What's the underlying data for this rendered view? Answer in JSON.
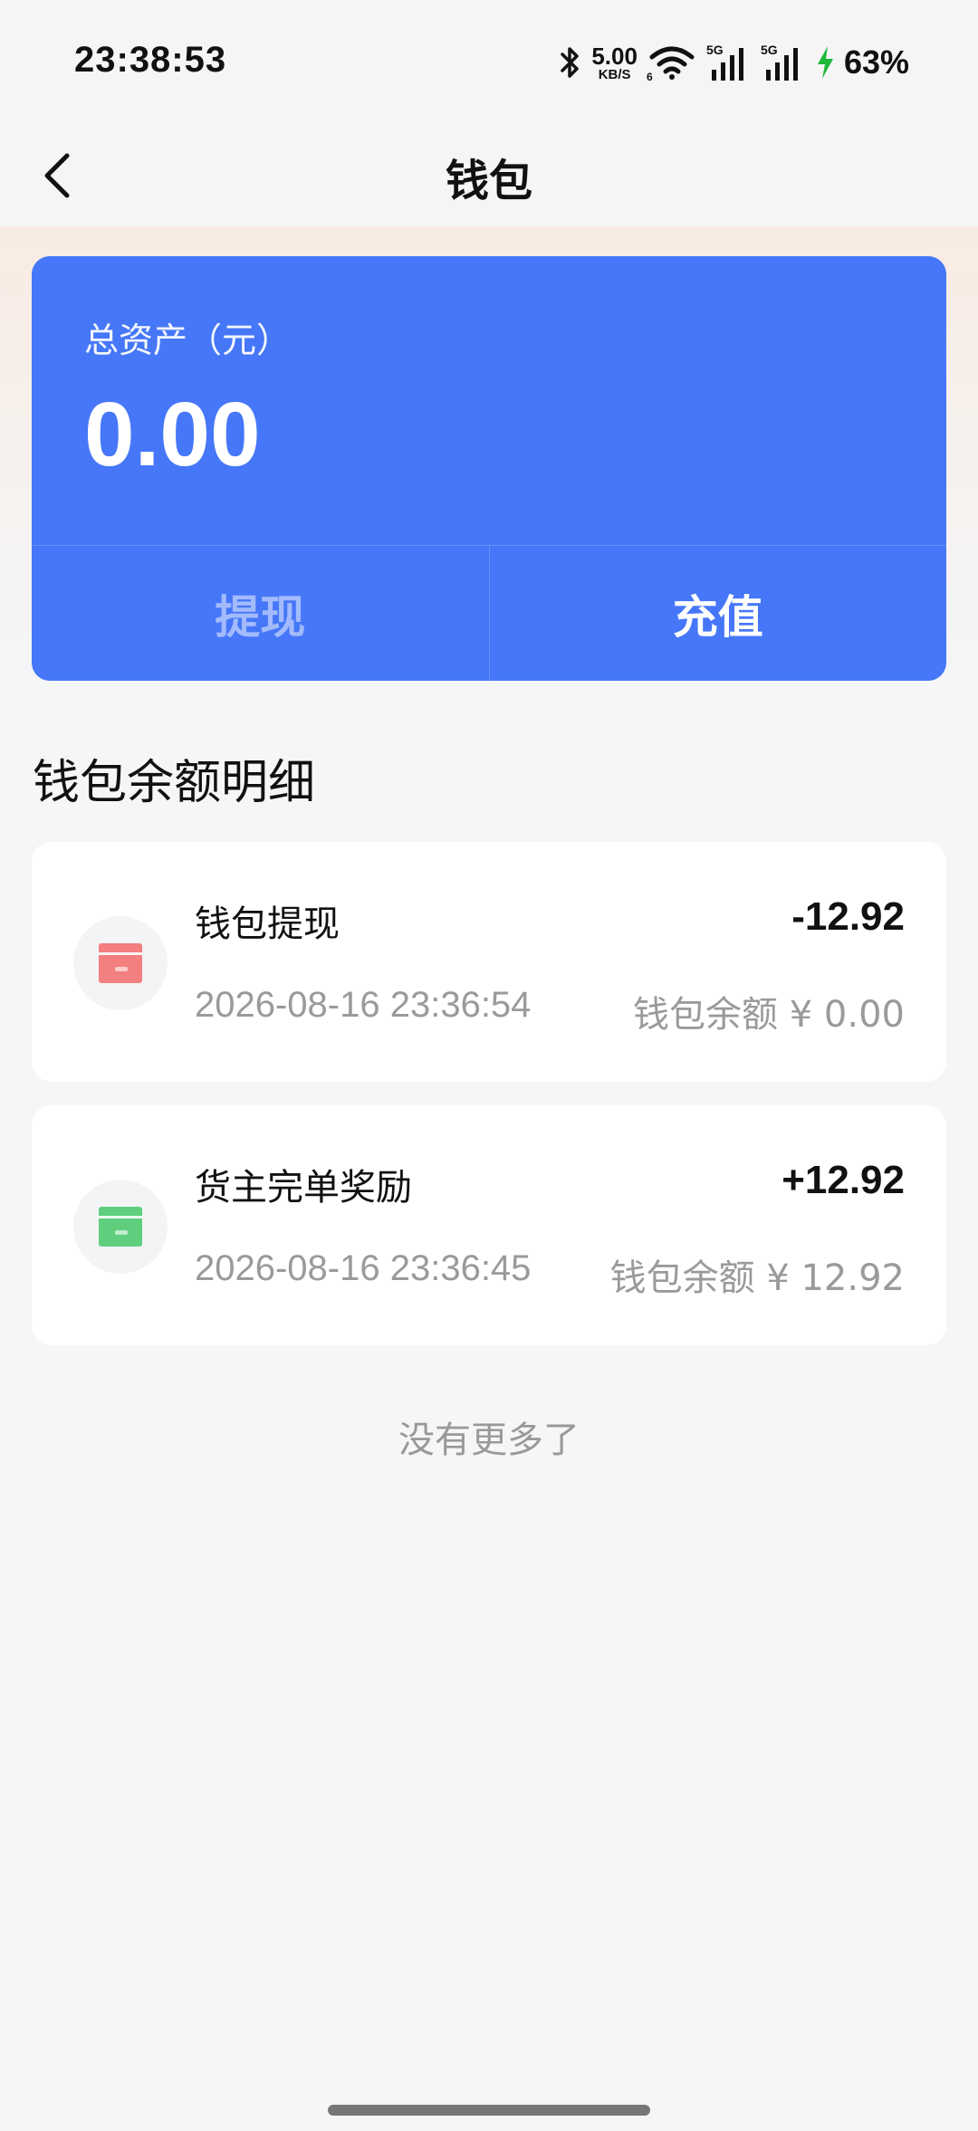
{
  "status_bar": {
    "time": "23:38:53",
    "net_speed_value": "5.00",
    "net_speed_unit": "KB/S",
    "wifi_sub": "6",
    "sim1_label": "5G",
    "sim2_label": "5G",
    "battery": "63%"
  },
  "nav": {
    "title": "钱包"
  },
  "asset_card": {
    "label": "总资产（元）",
    "amount": "0.00",
    "withdraw_label": "提现",
    "recharge_label": "充值"
  },
  "section": {
    "title": "钱包余额明细"
  },
  "records": [
    {
      "title": "钱包提现",
      "amount": "-12.92",
      "time": "2026-08-16 23:36:54",
      "balance": "钱包余额 ¥ 0.00",
      "icon": "withdraw-card-icon",
      "icon_color": "#f47f7f"
    },
    {
      "title": "货主完单奖励",
      "amount": "+12.92",
      "time": "2026-08-16 23:36:45",
      "balance": "钱包余额 ¥ 12.92",
      "icon": "reward-card-icon",
      "icon_color": "#5fcf7e"
    }
  ],
  "footer": {
    "no_more": "没有更多了"
  },
  "colors": {
    "accent": "#4677f8",
    "background": "#f5f6f8"
  }
}
